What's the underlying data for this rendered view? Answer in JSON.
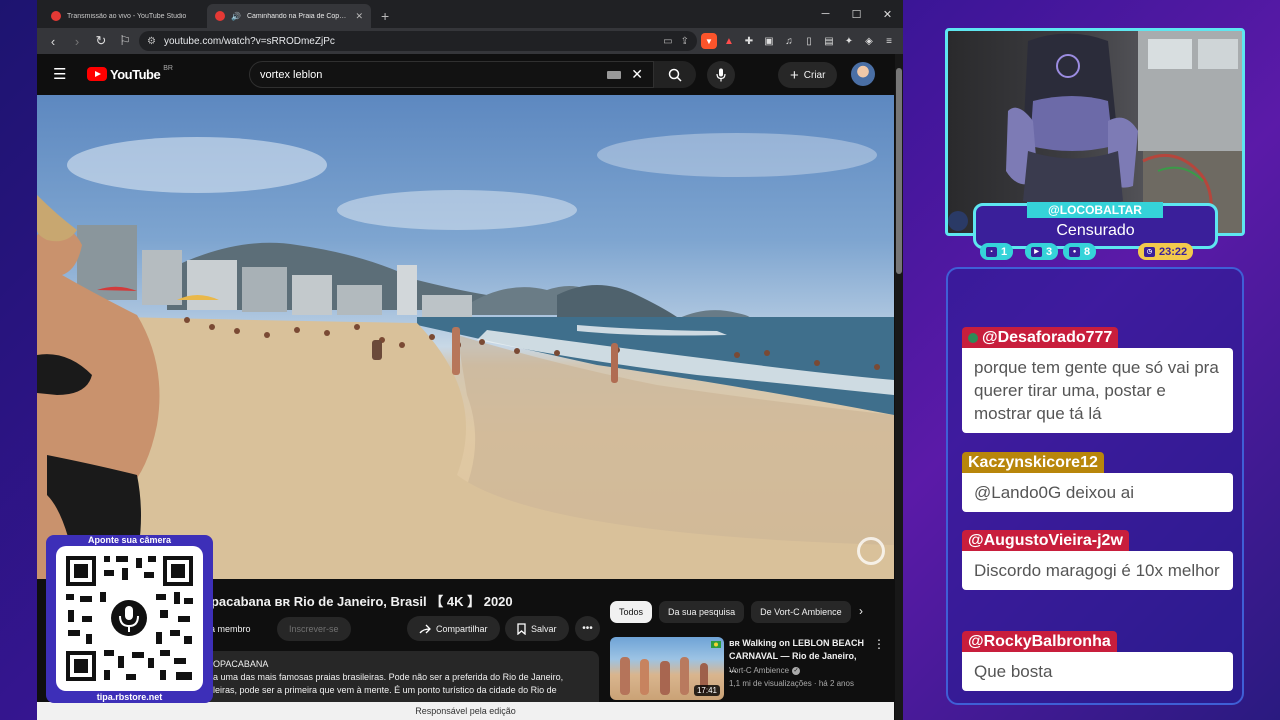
{
  "browser": {
    "tabs": [
      {
        "title": "Transmissão ao vivo - YouTube Studio",
        "active": false
      },
      {
        "title": "Caminhando na Praia de Copacabana",
        "active": true
      }
    ],
    "url": "youtube.com/watch?v=sRRODmeZjPc"
  },
  "youtube": {
    "logo_text": "YouTube",
    "country": "BR",
    "search_value": "vortex leblon",
    "create_label": "Criar",
    "video": {
      "title": "opacabana ʙʀ Rio de Janeiro, Brasil 【 4K 】 2020",
      "member_label": "eja membro",
      "subscribe_label": "Inscrever-se",
      "share_label": "Compartilhar",
      "save_label": "Salvar",
      "description": {
        "channel": "OPACABANA",
        "line1": "a uma das mais famosas praias brasileiras. Pode não ser a preferida do Rio de Janeiro,",
        "line2": "leiras, pode ser a primeira que vem à mente. É um ponto turístico da cidade do Rio de"
      }
    },
    "chips": [
      "Todos",
      "Da sua pesquisa",
      "De Vort-C Ambience"
    ],
    "recommendation": {
      "title": "ʙʀ Walking on LEBLON BEACH CARNAVAL — Rio de Janeiro, ...",
      "channel": "Vort-C Ambience",
      "meta": "1,1 mi de visualizações · há 2 anos",
      "duration": "17:41"
    },
    "edit_bar": "Responsável pela edição"
  },
  "qr": {
    "top_label": "Aponte sua câmera",
    "bottom_label": "tipa.rbstore.net"
  },
  "stream": {
    "username": "@LOCOBALTAR",
    "status": "Censurado",
    "stats": {
      "chat": "1",
      "youtube": "3",
      "followers": "8",
      "time": "23:22"
    }
  },
  "chat": [
    {
      "user": "@Desaforado777",
      "text": "porque tem gente que só vai pra querer tirar uma, postar e mostrar que tá lá",
      "style": "red",
      "badge": true
    },
    {
      "user": "Kaczynskicore12",
      "text": "@Lando0G deixou ai",
      "style": "gold",
      "badge": false
    },
    {
      "user": "@AugustoVieira-j2w",
      "text": "Discordo maragogi é 10x melhor",
      "style": "red",
      "badge": false
    },
    {
      "user": "@RockyBalbronha",
      "text": "Que bosta",
      "style": "red",
      "badge": false
    }
  ],
  "colors": {
    "accent_cyan": "#5ee6f0",
    "chat_user_red": "#c81e3c",
    "chat_user_gold": "#b8860b",
    "yt_red": "#ff0000"
  }
}
